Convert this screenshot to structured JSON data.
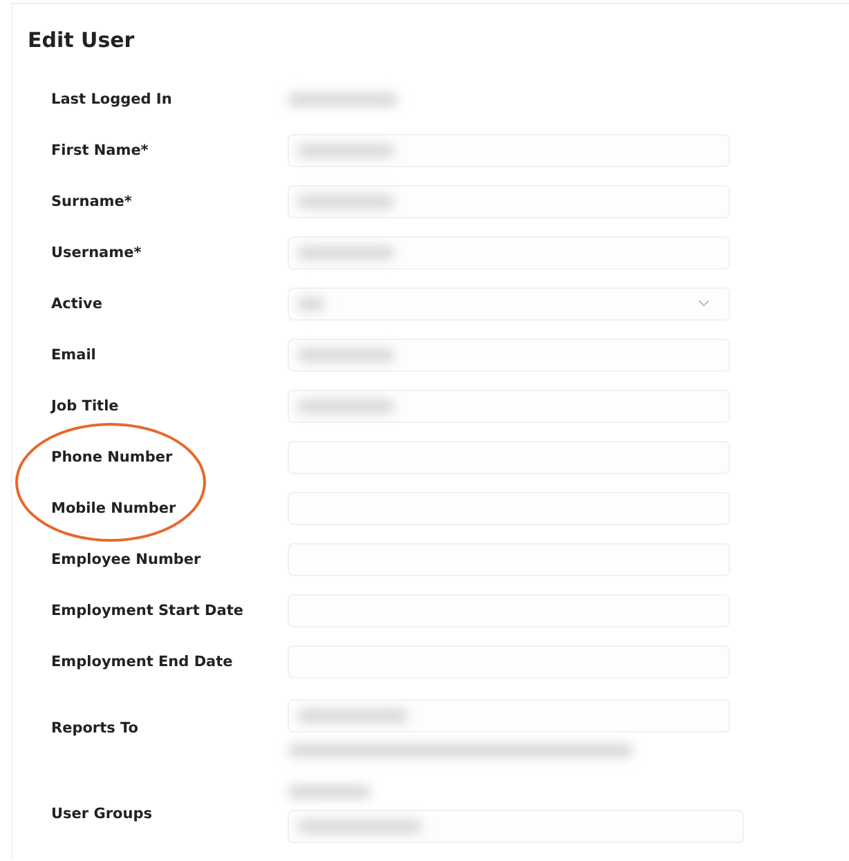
{
  "title": "Edit User",
  "rows": [
    {
      "label": "Last Logged In",
      "kind": "value",
      "filled": true,
      "highlighted": false
    },
    {
      "label": "First Name*",
      "kind": "field",
      "filled": true,
      "highlighted": false
    },
    {
      "label": "Surname*",
      "kind": "field",
      "filled": true,
      "highlighted": false
    },
    {
      "label": "Username*",
      "kind": "field",
      "filled": true,
      "highlighted": false
    },
    {
      "label": "Active",
      "kind": "select",
      "filled": true,
      "highlighted": false
    },
    {
      "label": "Email",
      "kind": "field",
      "filled": true,
      "highlighted": false
    },
    {
      "label": "Job Title",
      "kind": "field",
      "filled": true,
      "highlighted": false
    },
    {
      "label": "Phone Number",
      "kind": "field",
      "filled": false,
      "highlighted": true
    },
    {
      "label": "Mobile Number",
      "kind": "field",
      "filled": false,
      "highlighted": true
    },
    {
      "label": "Employee Number",
      "kind": "field",
      "filled": false,
      "highlighted": false
    },
    {
      "label": "Employment Start Date",
      "kind": "field",
      "filled": false,
      "highlighted": false
    },
    {
      "label": "Employment End Date",
      "kind": "field",
      "filled": false,
      "highlighted": false
    },
    {
      "label": "Reports To",
      "kind": "reference",
      "filled": true,
      "highlighted": false
    },
    {
      "label": "User Groups",
      "kind": "groups",
      "filled": true,
      "highlighted": false
    }
  ]
}
